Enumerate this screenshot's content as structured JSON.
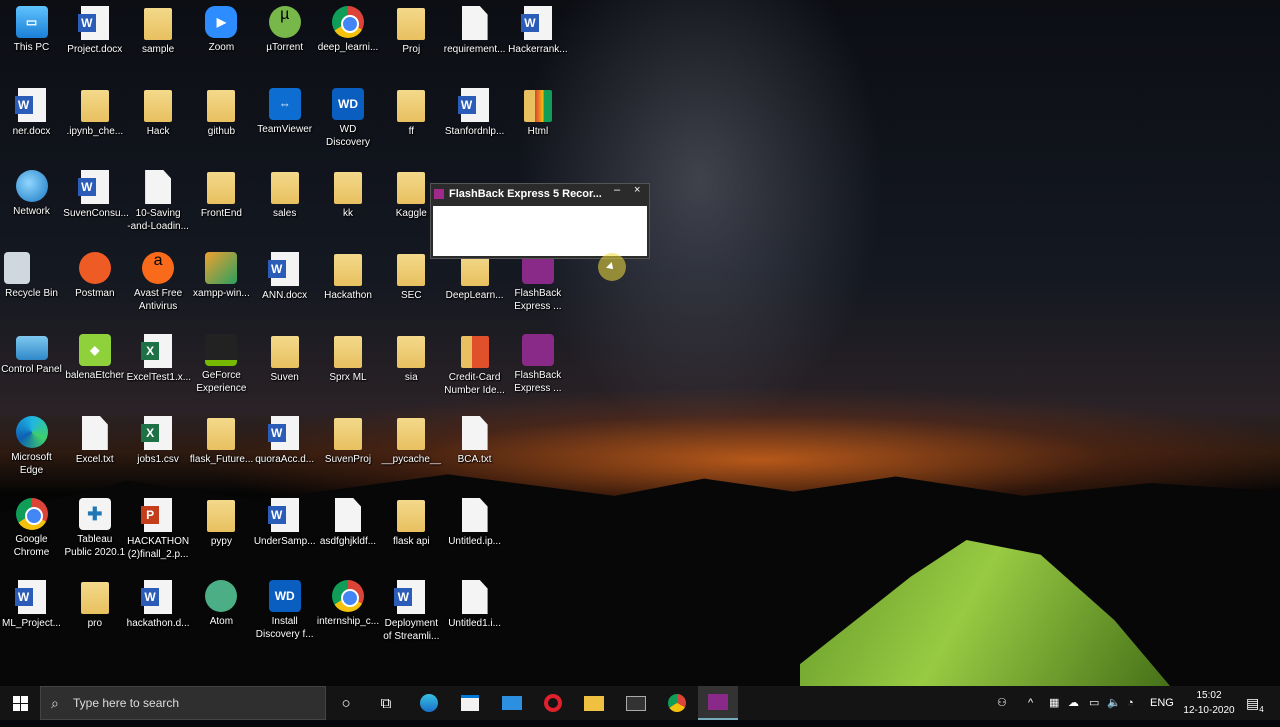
{
  "desktop": {
    "columns": [
      [
        {
          "label": "This PC",
          "type": "pc"
        },
        {
          "label": "ner.docx",
          "type": "word"
        },
        {
          "label": "Network",
          "type": "network"
        },
        {
          "label": "Recycle Bin",
          "type": "recycle"
        },
        {
          "label": "Control Panel",
          "type": "control"
        },
        {
          "label": "Microsoft\nEdge",
          "type": "edge"
        },
        {
          "label": "Google\nChrome",
          "type": "chrome"
        },
        {
          "label": "ML_Project...",
          "type": "word"
        }
      ],
      [
        {
          "label": "Project.docx",
          "type": "word"
        },
        {
          "label": ".ipynb_che...",
          "type": "folder"
        },
        {
          "label": "SuvenConsu...",
          "type": "word"
        },
        {
          "label": "Postman",
          "type": "postman"
        },
        {
          "label": "balenaEtcher",
          "type": "etcher"
        },
        {
          "label": "Excel.txt",
          "type": "file"
        },
        {
          "label": "Tableau\nPublic 2020.1",
          "type": "tableau"
        },
        {
          "label": "pro",
          "type": "folder"
        }
      ],
      [
        {
          "label": "sample",
          "type": "folder"
        },
        {
          "label": "Hack",
          "type": "folder"
        },
        {
          "label": "10-Saving\n-and-Loadin...",
          "type": "file"
        },
        {
          "label": "Avast Free\nAntivirus",
          "type": "avast"
        },
        {
          "label": "ExcelTest1.x...",
          "type": "excel"
        },
        {
          "label": "jobs1.csv",
          "type": "excel"
        },
        {
          "label": "HACKATHON\n(2)finall_2.p...",
          "type": "ppt"
        },
        {
          "label": "hackathon.d...",
          "type": "word"
        }
      ],
      [
        {
          "label": "Zoom",
          "type": "zoom"
        },
        {
          "label": "github",
          "type": "folder"
        },
        {
          "label": "FrontEnd",
          "type": "folder"
        },
        {
          "label": "xampp-win...",
          "type": "xampp"
        },
        {
          "label": "GeForce\nExperience",
          "type": "nvidia"
        },
        {
          "label": "flask_Future...",
          "type": "folder"
        },
        {
          "label": "pypy",
          "type": "folder"
        },
        {
          "label": "Atom",
          "type": "atom"
        }
      ],
      [
        {
          "label": "µTorrent",
          "type": "utorrent"
        },
        {
          "label": "TeamViewer",
          "type": "teamviewer"
        },
        {
          "label": "sales",
          "type": "folder"
        },
        {
          "label": "ANN.docx",
          "type": "word"
        },
        {
          "label": "Suven",
          "type": "folder"
        },
        {
          "label": "quoraAcc.d...",
          "type": "word"
        },
        {
          "label": "UnderSamp...",
          "type": "word"
        },
        {
          "label": "Install\nDiscovery f...",
          "type": "wd"
        }
      ],
      [
        {
          "label": "deep_learni...",
          "type": "chrome"
        },
        {
          "label": "WD\nDiscovery",
          "type": "wd"
        },
        {
          "label": "kk",
          "type": "folder"
        },
        {
          "label": "Hackathon",
          "type": "folder"
        },
        {
          "label": "Sprx ML",
          "type": "folder"
        },
        {
          "label": "SuvenProj",
          "type": "folder"
        },
        {
          "label": "asdfghjkldf...",
          "type": "file"
        },
        {
          "label": "internship_c...",
          "type": "chrome"
        }
      ],
      [
        {
          "label": "Proj",
          "type": "folder"
        },
        {
          "label": "ff",
          "type": "folder"
        },
        {
          "label": "Kaggle",
          "type": "folder"
        },
        {
          "label": "SEC",
          "type": "folder"
        },
        {
          "label": "sia",
          "type": "folder"
        },
        {
          "label": "__pycache__",
          "type": "folder"
        },
        {
          "label": "flask api",
          "type": "folder"
        },
        {
          "label": "Deployment\nof Streamli...",
          "type": "word"
        }
      ],
      [
        {
          "label": "requirement...",
          "type": "file"
        },
        {
          "label": "Stanfordnlp...",
          "type": "word"
        },
        null,
        {
          "label": "DeepLearn...",
          "type": "folder"
        },
        {
          "label": "Credit-Card\nNumber Ide...",
          "type": "redfolder"
        },
        {
          "label": "BCA.txt",
          "type": "file"
        },
        {
          "label": "Untitled.ip...",
          "type": "file"
        },
        {
          "label": "Untitled1.i...",
          "type": "file"
        }
      ],
      [
        {
          "label": "Hackerrank...",
          "type": "word"
        },
        {
          "label": "Html",
          "type": "htmlfolder"
        },
        null,
        {
          "label": "FlashBack\nExpress ...",
          "type": "flashback"
        },
        {
          "label": "FlashBack\nExpress ...",
          "type": "flashback"
        },
        null,
        null,
        null
      ]
    ]
  },
  "window": {
    "title": "FlashBack Express 5 Recor...",
    "minimize": "–",
    "close": "×"
  },
  "taskbar": {
    "start_icon": "windows-logo",
    "search_placeholder": "Type here to search",
    "lang": "ENG",
    "time": "15:02",
    "date": "12-10-2020",
    "notifications": "4"
  }
}
